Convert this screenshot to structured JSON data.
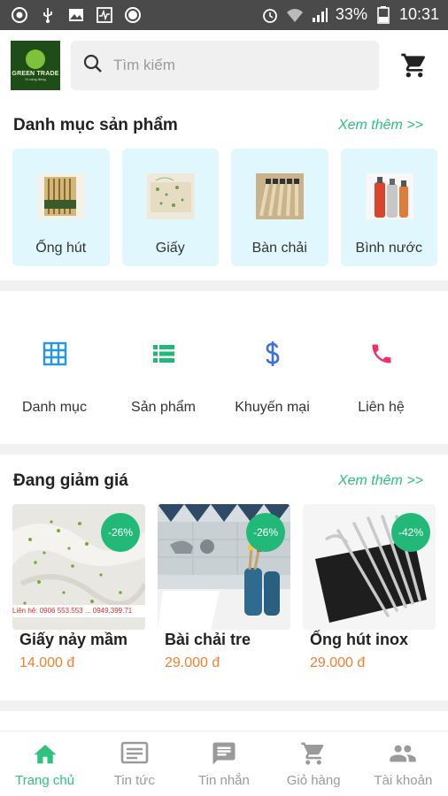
{
  "status_bar": {
    "battery": "33%",
    "time": "10:31"
  },
  "header": {
    "logo_text": "GREEN TRADE",
    "logo_sub": "Vì cộng đồng",
    "search_placeholder": "Tìm kiếm"
  },
  "categories": {
    "title": "Danh mục sản phẩm",
    "see_more": "Xem thêm >>",
    "items": [
      {
        "label": "Ống hút"
      },
      {
        "label": "Giấy"
      },
      {
        "label": "Bàn chải"
      },
      {
        "label": "Bình nước"
      }
    ]
  },
  "quick_menu": [
    {
      "label": "Danh mục",
      "icon": "grid-icon",
      "color": "#2196f3"
    },
    {
      "label": "Sản phẩm",
      "icon": "list-icon",
      "color": "#22b978"
    },
    {
      "label": "Khuyến mại",
      "icon": "dollar-icon",
      "color": "#3d6fe0"
    },
    {
      "label": "Liên hệ",
      "icon": "phone-icon",
      "color": "#f0306a"
    }
  ],
  "sale": {
    "title": "Đang giảm giá",
    "see_more": "Xem thêm >>",
    "products": [
      {
        "name": "Giấy nảy mầm",
        "price": "14.000 đ",
        "discount": "-26%",
        "image_caption": "Liên hệ: 0906 553.553 ... 0949.399.71"
      },
      {
        "name": "Bài chải tre",
        "price": "29.000 đ",
        "discount": "-26%"
      },
      {
        "name": "Ống hút inox",
        "price": "29.000 đ",
        "discount": "-42%"
      }
    ]
  },
  "bottom_nav": [
    {
      "label": "Trang chủ",
      "icon": "home-icon",
      "active": true
    },
    {
      "label": "Tin tức",
      "icon": "news-icon",
      "active": false
    },
    {
      "label": "Tin nhắn",
      "icon": "message-icon",
      "active": false
    },
    {
      "label": "Giỏ hàng",
      "icon": "cart-icon",
      "active": false
    },
    {
      "label": "Tài khoản",
      "icon": "account-icon",
      "active": false
    }
  ],
  "colors": {
    "accent": "#2ec27e",
    "price": "#f08030",
    "category_bg": "#e0f7fd",
    "status_bar": "#4a4a4a"
  }
}
